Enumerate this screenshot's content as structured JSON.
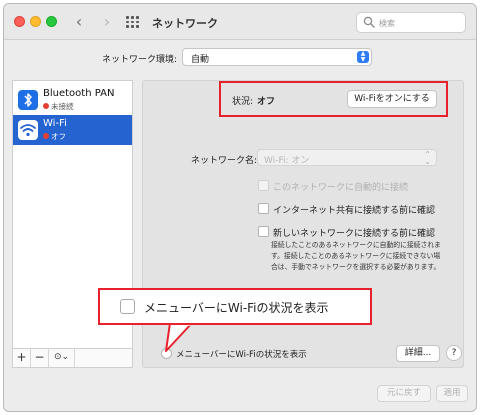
{
  "window": {
    "title": "ネットワーク"
  },
  "search": {
    "placeholder": "検索"
  },
  "location": {
    "label": "ネットワーク環境:",
    "value": "自動"
  },
  "sidebar": {
    "items": [
      {
        "name": "Bluetooth PAN",
        "status": "未接続",
        "icon": "bluetooth-icon"
      },
      {
        "name": "Wi-Fi",
        "status": "オフ",
        "icon": "wifi-icon"
      }
    ],
    "footer": {
      "add": "+",
      "remove": "−",
      "action": "⊙⌄"
    }
  },
  "status": {
    "label": "状況:",
    "value": "オフ",
    "button": "Wi-Fiをオンにする"
  },
  "network_name": {
    "label": "ネットワーク名:",
    "value": "Wi-Fi: オン"
  },
  "options": [
    {
      "label": "このネットワークに自動的に接続",
      "disabled": true
    },
    {
      "label": "インターネット共有に接続する前に確認",
      "disabled": false
    },
    {
      "label": "新しいネットワークに接続する前に確認",
      "disabled": false
    }
  ],
  "description": "接続したことのあるネットワークに自動的に接続されます。接続したことのあるネットワークに接続できない場合は、手動でネットワークを選択する必要があります。",
  "menubar": {
    "label": "メニューバーにWi-Fiの状況を表示"
  },
  "buttons": {
    "details": "詳細...",
    "help": "?",
    "revert": "元に戻す",
    "apply": "適用"
  },
  "callout": {
    "label": "メニューバーにWi-Fiの状況を表示"
  },
  "colors": {
    "selection": "#2563d0",
    "highlight": "#e8222d",
    "status_dot": "#e23f33"
  }
}
